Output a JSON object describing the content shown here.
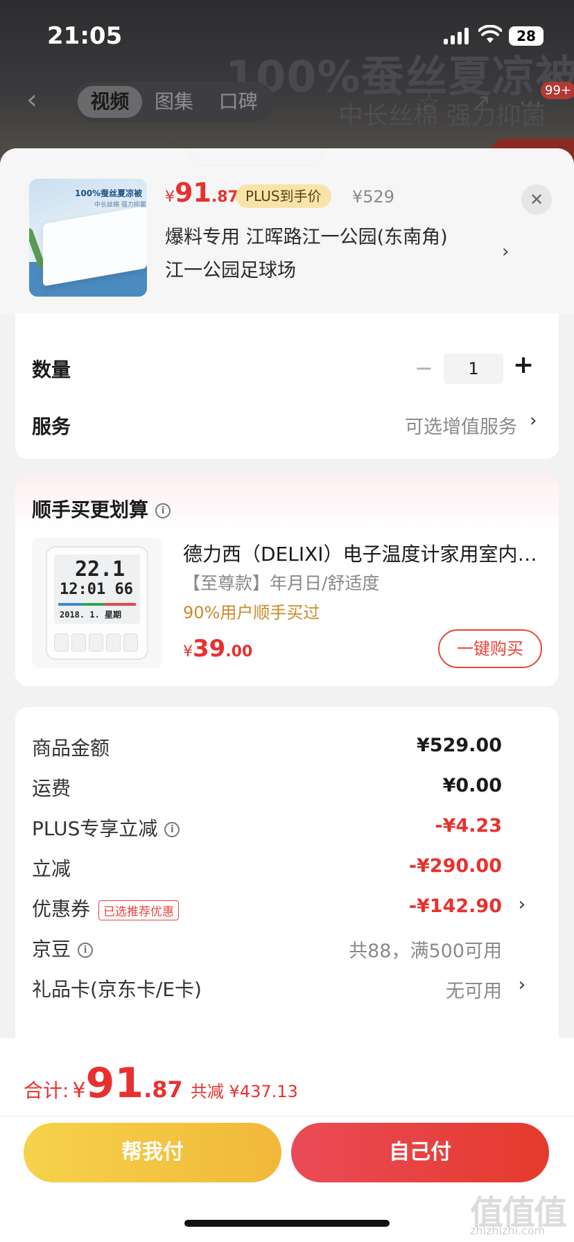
{
  "status": {
    "time": "21:05",
    "battery": "28"
  },
  "background": {
    "banner_title": "100%蚕丝夏凉被",
    "banner_sub": "中长丝棉 强力抑菌",
    "cart_badge": "99+"
  },
  "nav": {
    "tabs": [
      {
        "label": "视频",
        "active": true
      },
      {
        "label": "图集",
        "active": false
      },
      {
        "label": "口碑",
        "active": false
      }
    ]
  },
  "product": {
    "thumb_title": "100%蚕丝夏凉被",
    "thumb_sub": "中长丝棉 强力抑菌",
    "price_yen": "¥",
    "price_int": "91",
    "price_dec": ".87",
    "plus_tag": "PLUS到手价",
    "original_price": "¥529",
    "address_line1": "爆料专用  江晖路江一公园(东南角)",
    "address_line2": "江一公园足球场"
  },
  "options": {
    "quantity_label": "数量",
    "quantity_value": "1",
    "service_label": "服务",
    "service_value": "可选增值服务"
  },
  "bundle": {
    "title": "顺手买更划算",
    "item_name": "德力西（DELIXI）电子温度计家用室内高精度温湿度计",
    "item_spec": "【至尊款】年月日/舒适度",
    "item_bought": "90%用户顺手买过",
    "price_yen": "¥",
    "price_int": "39",
    "price_dec": ".00",
    "buy_button": "一键购买",
    "display_temp": "22.1",
    "display_hum": "12:01 66",
    "display_date": "2018. 1. 星期"
  },
  "summary": {
    "rows": [
      {
        "label": "商品金额",
        "value": "¥529.00"
      },
      {
        "label": "运费",
        "value": "¥0.00"
      },
      {
        "label": "PLUS专享立减",
        "value": "-¥4.23"
      },
      {
        "label": "立减",
        "value": "-¥290.00"
      },
      {
        "label": "优惠券",
        "tag": "已选推荐优惠",
        "value": "-¥142.90"
      },
      {
        "label": "京豆",
        "value": "共88，满500可用"
      },
      {
        "label": "礼品卡(京东卡/E卡)",
        "value": "无可用"
      }
    ]
  },
  "footer": {
    "total_label": "合计:",
    "total_yen": "¥",
    "total_int": "91",
    "total_dec": ".87",
    "total_saved": "共减 ¥437.13",
    "help_pay": "帮我付",
    "self_pay": "自己付",
    "watermark": "值值值",
    "watermark_url": "zhizhizhi.com"
  },
  "colors": {
    "accent_red": "#e8312f",
    "gold": "#f1b83a",
    "plus_tag_bg": "#f8e4a8"
  }
}
